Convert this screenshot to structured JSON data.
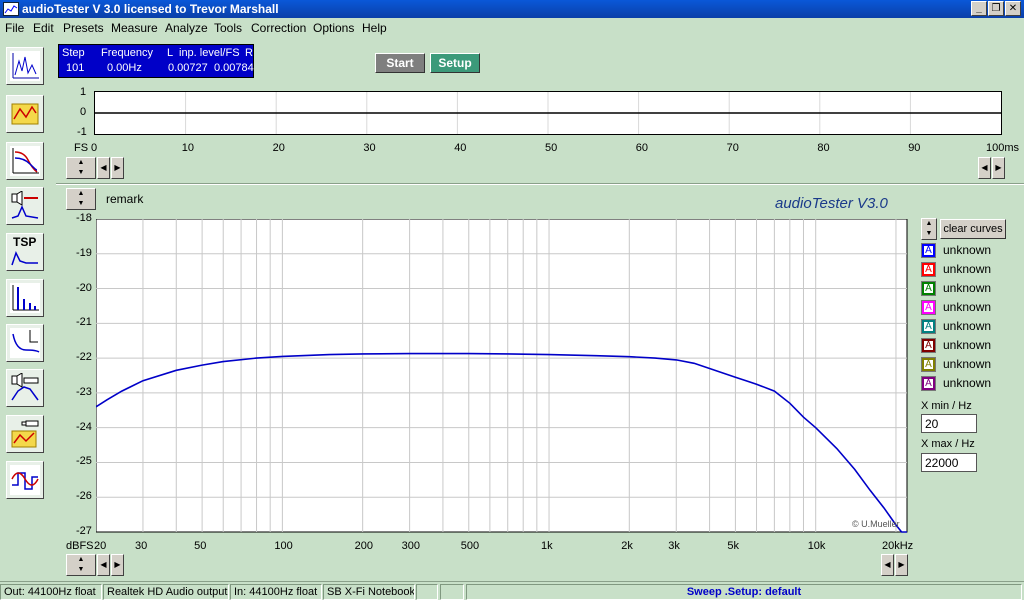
{
  "window": {
    "title": "audioTester  V 3.0   licensed to Trevor Marshall",
    "minimize_glyph": "_",
    "restore_glyph": "❐",
    "close_glyph": "✕"
  },
  "menu": [
    "File",
    "Edit",
    "Presets",
    "Measure",
    "Analyze",
    "Tools",
    "Correction",
    "Options",
    "Help"
  ],
  "status_panel": {
    "headers": {
      "step": "Step",
      "frequency": "Frequency",
      "l": "L",
      "inp_level": "inp. level/FS",
      "r": "R"
    },
    "values": {
      "step": "101",
      "frequency": "0.00Hz",
      "l": "0.00727",
      "r": "0.00784"
    }
  },
  "buttons": {
    "start": "Start",
    "setup": "Setup",
    "clear_curves": "clear curves"
  },
  "toolbar_icons": [
    "spectrum-analyzer-icon",
    "notes-icon",
    "frequency-response-icon",
    "speaker-impedance-icon",
    "tsp-icon",
    "distortion-icon",
    "waterfall-icon",
    "speaker-sweep-icon",
    "calibration-icon",
    "oscilloscope-icon"
  ],
  "tsp_label": "TSP",
  "scope": {
    "y_ticks": [
      "1",
      "0",
      "-1"
    ],
    "x_unit_label": "FS",
    "x_ticks": [
      "0",
      "10",
      "20",
      "30",
      "40",
      "50",
      "60",
      "70",
      "80",
      "90",
      "100ms"
    ]
  },
  "main_chart": {
    "remark_label": "remark",
    "brand": "audioTester  V3.0",
    "copyright": "© U.Mueller",
    "y_unit": "dBFS",
    "y_ticks": [
      "-18",
      "-19",
      "-20",
      "-21",
      "-22",
      "-23",
      "-24",
      "-25",
      "-26",
      "-27"
    ],
    "x_ticks": [
      "20",
      "30",
      "50",
      "100",
      "200",
      "300",
      "500",
      "1k",
      "2k",
      "3k",
      "5k",
      "10k",
      "20kHz"
    ]
  },
  "chart_data": {
    "type": "line",
    "x_scale": "log",
    "xlim": [
      20,
      22000
    ],
    "ylim": [
      -27,
      -18
    ],
    "ylabel": "dBFS",
    "xlabel": "",
    "grid": true,
    "line_color": "#0000c8",
    "series": [
      {
        "x": [
          20,
          22,
          25,
          30,
          40,
          50,
          60,
          80,
          100,
          150,
          200,
          300,
          500,
          700,
          1000,
          1500,
          2000,
          2500,
          3000,
          3500,
          4000,
          5000,
          6000,
          7000,
          8000,
          9000,
          10000,
          12000,
          14000,
          16000,
          18000,
          20000,
          21000,
          22000
        ],
        "y": [
          -23.4,
          -23.2,
          -22.95,
          -22.65,
          -22.35,
          -22.2,
          -22.1,
          -22.0,
          -21.95,
          -21.9,
          -21.88,
          -21.87,
          -21.87,
          -21.88,
          -21.9,
          -21.93,
          -21.96,
          -22.0,
          -22.05,
          -22.15,
          -22.3,
          -22.55,
          -22.75,
          -22.95,
          -23.3,
          -23.7,
          -24.0,
          -24.6,
          -25.2,
          -25.8,
          -26.3,
          -26.8,
          -27.0,
          -27.0
        ]
      }
    ]
  },
  "legend": [
    {
      "glyph": "A",
      "label": "unknown",
      "color": "#0000ff"
    },
    {
      "glyph": "A",
      "label": "unknown",
      "color": "#ff0000"
    },
    {
      "glyph": "A",
      "label": "unknown",
      "color": "#008000"
    },
    {
      "glyph": "A",
      "label": "unknown",
      "color": "#ff00ff"
    },
    {
      "glyph": "A",
      "label": "unknown",
      "color": "#008080"
    },
    {
      "glyph": "A",
      "label": "unknown",
      "color": "#800000"
    },
    {
      "glyph": "A",
      "label": "unknown",
      "color": "#808000"
    },
    {
      "glyph": "A",
      "label": "unknown",
      "color": "#800080"
    }
  ],
  "xrange": {
    "min_label": "X min / Hz",
    "min_value": "20",
    "max_label": "X max / Hz",
    "max_value": "22000"
  },
  "statusbar": {
    "out": "Out: 44100Hz float",
    "out_device": "Realtek HD Audio output",
    "in": "In: 44100Hz float",
    "in_device": "SB X-Fi Notebook",
    "message": "Sweep  .Setup:  default"
  },
  "colors": {
    "background": "#c8e0c8",
    "panel_blue": "#0000c8",
    "start_button": "#7f7f7f",
    "setup_button": "#3c9a7a"
  }
}
